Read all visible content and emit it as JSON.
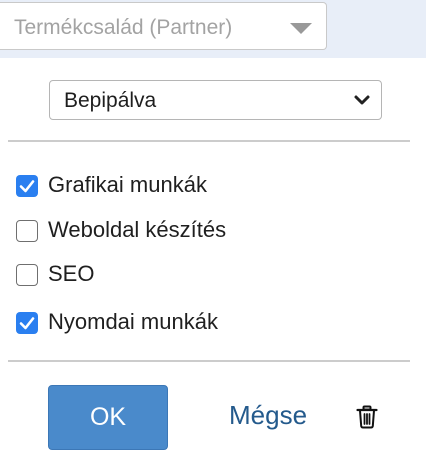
{
  "product_family": {
    "placeholder": "Termékcsalád (Partner)",
    "icon": "caret-down-icon"
  },
  "status_select": {
    "value": "Bepipálva",
    "icon": "chevron-down-icon"
  },
  "options": [
    {
      "label": "Grafikai munkák",
      "checked": true
    },
    {
      "label": "Weboldal készítés",
      "checked": false
    },
    {
      "label": "SEO",
      "checked": false
    },
    {
      "label": "Nyomdai munkák",
      "checked": true
    }
  ],
  "actions": {
    "ok_label": "OK",
    "cancel_label": "Mégse",
    "delete_icon": "trash-icon"
  },
  "colors": {
    "accent": "#2a7ff0",
    "ok_button": "#4a8acb",
    "link": "#245a8c",
    "topbar": "#e8eef8"
  }
}
